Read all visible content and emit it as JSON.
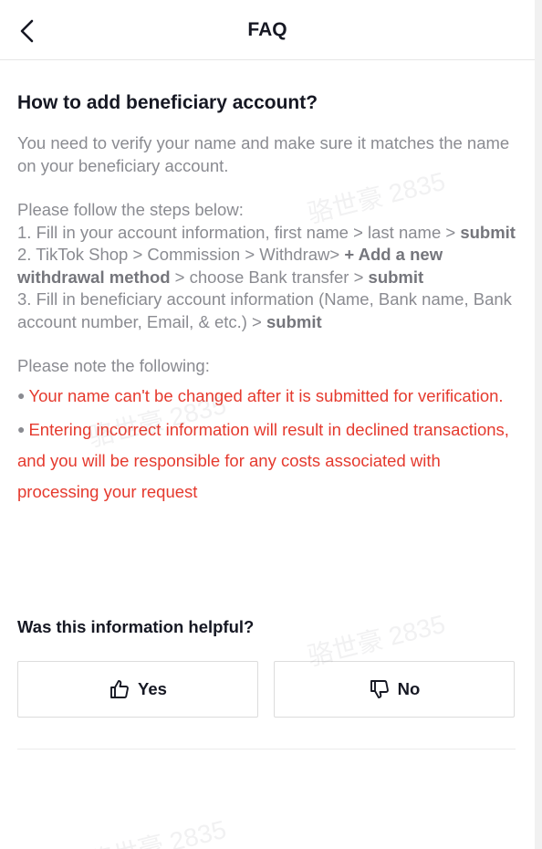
{
  "header": {
    "title": "FAQ",
    "back_icon": "chevron-left-icon"
  },
  "article": {
    "question": "How to add beneficiary account?",
    "intro": "You need to verify your name and make sure it matches the name on your beneficiary account.",
    "steps_heading": "Please follow the steps below:",
    "step1_text": "1. Fill in your account information, first name > last name > ",
    "step1_bold": "submit",
    "step2_text_a": "2. TikTok Shop > Commission > Withdraw> ",
    "step2_bold_a": "+ Add a new withdrawal method",
    "step2_text_b": " > choose Bank transfer > ",
    "step2_bold_b": "submit",
    "step3_text": "3. Fill in beneficiary account information (Name, Bank name, Bank account number, Email, & etc.) > ",
    "step3_bold": "submit",
    "note_heading": "Please note the following:",
    "warning1": "Your name can't be changed after it is submitted for verification.",
    "warning2": "Entering incorrect information will result in declined transactions, and you will be responsible for any costs associated with processing your request",
    "warning_color": "#e53a2e"
  },
  "feedback": {
    "question": "Was this information helpful?",
    "yes_label": "Yes",
    "no_label": "No",
    "yes_icon": "thumbs-up-icon",
    "no_icon": "thumbs-down-icon"
  },
  "watermark": {
    "text": "骆世豪 2835"
  }
}
